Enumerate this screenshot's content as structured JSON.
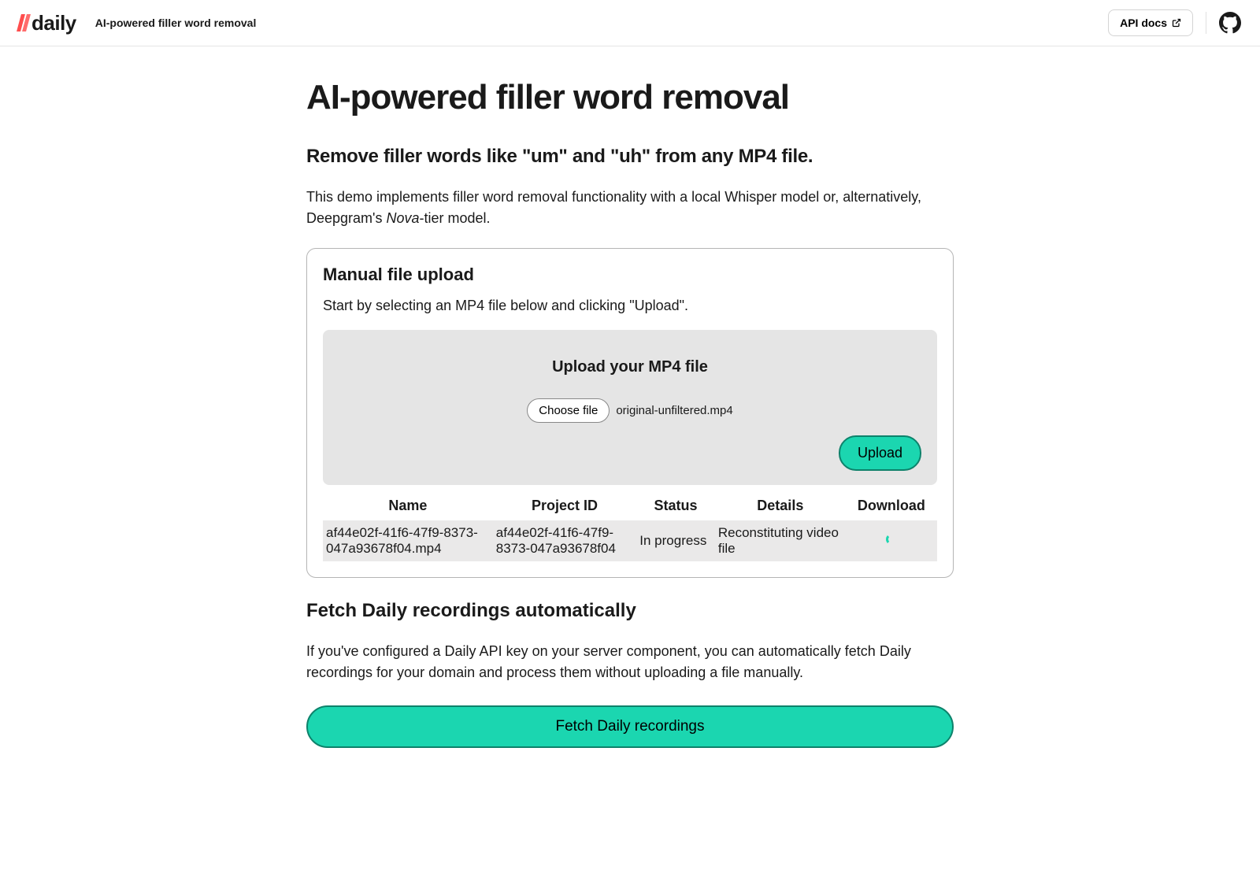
{
  "header": {
    "logo_text": "daily",
    "subtitle": "AI-powered filler word removal",
    "api_docs_label": "API docs"
  },
  "main": {
    "title": "AI-powered filler word removal",
    "subtitle": "Remove filler words like \"um\" and \"uh\" from any MP4 file.",
    "description_pre": "This demo implements filler word removal functionality with a local Whisper model or, alternatively, Deepgram's ",
    "description_em": "Nova",
    "description_post": "-tier model."
  },
  "upload_card": {
    "title": "Manual file upload",
    "instruction": "Start by selecting an MP4 file below and clicking \"Upload\".",
    "upload_label": "Upload your MP4 file",
    "choose_file_label": "Choose file",
    "selected_file": "original-unfiltered.mp4",
    "upload_button": "Upload",
    "table": {
      "headers": [
        "Name",
        "Project ID",
        "Status",
        "Details",
        "Download"
      ],
      "rows": [
        {
          "name": "af44e02f-41f6-47f9-8373-047a93678f04.mp4",
          "project_id": "af44e02f-41f6-47f9-8373-047a93678f04",
          "status": "In progress",
          "details": "Reconstituting video file"
        }
      ]
    }
  },
  "fetch_section": {
    "title": "Fetch Daily recordings automatically",
    "text": "If you've configured a Daily API key on your server component, you can automatically fetch Daily recordings for your domain and process them without uploading a file manually.",
    "button": "Fetch Daily recordings"
  }
}
